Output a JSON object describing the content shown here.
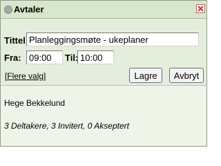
{
  "dialog": {
    "title": "Avtaler",
    "close_icon": "close-icon"
  },
  "form": {
    "title_label": "Tittel:",
    "title_value": "Planleggingsmøte - ukeplaner",
    "from_label": "Fra:",
    "from_value": "09:00",
    "to_label": "Til:",
    "to_value": "10:00",
    "more_options_open": "[",
    "more_options_link": "Flere valg",
    "more_options_close": "]",
    "save_label": "Lagre",
    "cancel_label": "Avbryt"
  },
  "info": {
    "person": "Hege Bekkelund",
    "summary": "3 Deltakere, 3 Invitert, 0 Akseptert"
  },
  "colors": {
    "panel": "#e4eedc",
    "info_panel": "#eef4e8",
    "close_icon": "#c0392b"
  }
}
